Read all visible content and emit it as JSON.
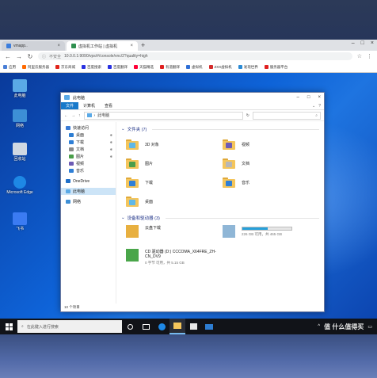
{
  "browser": {
    "tabs": [
      {
        "label": "vmapp.."
      },
      {
        "label": "虚拟机工作站 | 虚拟机"
      }
    ],
    "new_tab_label": "+",
    "address": {
      "security_label": "不安全",
      "url": "10.0.0.1:9090/vps/#/console/vnc/2?quality=high"
    },
    "bookmarks": [
      {
        "label": "应用",
        "color": "#4a7fd6"
      },
      {
        "label": "阿里云服务器",
        "color": "#ff6a00"
      },
      {
        "label": "京东商城",
        "color": "#e1251b"
      },
      {
        "label": "百度搜索",
        "color": "#2932e1"
      },
      {
        "label": "百度翻译",
        "color": "#2932e1"
      },
      {
        "label": "天猫精选",
        "color": "#ff0036"
      },
      {
        "label": "有道翻译",
        "color": "#e02020"
      },
      {
        "label": "虚拟机",
        "color": "#2f6fd6"
      },
      {
        "label": "ZXX虚拟机",
        "color": "#d42b2b"
      },
      {
        "label": "发现世界",
        "color": "#2b8ad4"
      },
      {
        "label": "服务器平台",
        "color": "#e02020"
      }
    ]
  },
  "desktop": {
    "icons": [
      {
        "label": "此电脑",
        "color": "#5aa9e6"
      },
      {
        "label": "网络",
        "color": "#3d8fd6"
      },
      {
        "label": "回收站",
        "color": "#cfd8e3"
      },
      {
        "label": "Microsoft Edge",
        "color": "#1e88e5"
      },
      {
        "label": "飞书",
        "color": "#3b7bf2"
      }
    ]
  },
  "explorer": {
    "title": "此电脑",
    "ribbon_tabs": [
      "文件",
      "计算机",
      "查看"
    ],
    "path_root": "此电脑",
    "search_placeholder": "搜索\"此电脑\"",
    "nav_items": [
      {
        "label": "快速访问",
        "color": "#3a7bd5",
        "indent": false,
        "pinned": false
      },
      {
        "label": "桌面",
        "color": "#2d7dd2",
        "indent": true,
        "pinned": true
      },
      {
        "label": "下载",
        "color": "#2f7fd6",
        "indent": true,
        "pinned": true
      },
      {
        "label": "文档",
        "color": "#8a8a8a",
        "indent": true,
        "pinned": true
      },
      {
        "label": "图片",
        "color": "#4a9e4a",
        "indent": true,
        "pinned": true
      },
      {
        "label": "视频",
        "color": "#6d5bb5",
        "indent": true,
        "pinned": false
      },
      {
        "label": "音乐",
        "color": "#2f7fd6",
        "indent": true,
        "pinned": false
      },
      {
        "label": "OneDrive",
        "color": "#1f6fc9",
        "indent": false,
        "pinned": false
      },
      {
        "label": "此电脑",
        "color": "#5aa9e6",
        "indent": false,
        "pinned": false
      },
      {
        "label": "网络",
        "color": "#3d8fd6",
        "indent": false,
        "pinned": false
      }
    ],
    "folders_header": "文件夹 (7)",
    "folders": [
      {
        "label": "3D 对象",
        "color": "#5fb8e8"
      },
      {
        "label": "视频",
        "color": "#6d5bb5"
      },
      {
        "label": "图片",
        "color": "#4a9e4a"
      },
      {
        "label": "文档",
        "color": "#b7b7b7"
      },
      {
        "label": "下载",
        "color": "#2f7fd6"
      },
      {
        "label": "音乐",
        "color": "#2f7fd6"
      },
      {
        "label": "桌面",
        "color": "#5fb8e8"
      }
    ],
    "drives_header": "设备和驱动器 (3)",
    "drives": [
      {
        "label": "云盘下载",
        "sub": "",
        "bar": null,
        "color": "#e8b040"
      },
      {
        "label": "",
        "sub": "226 GB 可用，共 465 GB",
        "bar": 0.52,
        "color": "#8fb6d6"
      },
      {
        "label": "CD 驱动器 (D:) CCCOMA_X64FRE_ZH-CN_DV9",
        "sub": "0 字节 可用，共 5.15 GB",
        "bar": null,
        "color": "#4aa64a"
      }
    ],
    "status": "10 个项目"
  },
  "taskbar": {
    "search_placeholder": "在此键入进行搜索",
    "watermark": "值 什么值得买"
  }
}
